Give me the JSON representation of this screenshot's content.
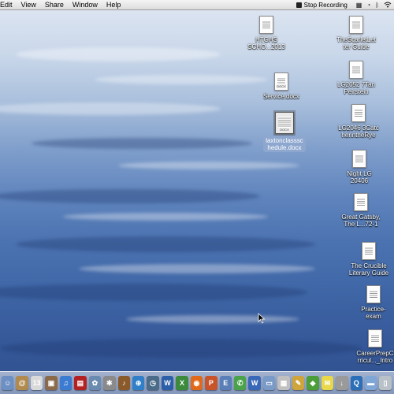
{
  "menubar": {
    "items": [
      "Edit",
      "View",
      "Share",
      "Window",
      "Help"
    ],
    "stop_recording": "Stop Recording"
  },
  "desktop_icons": [
    {
      "label1": "HTGHS",
      "label2": "SCHO...2013",
      "badge": "",
      "selected": false
    },
    {
      "label1": "TheScarletLet",
      "label2": "ter Guide",
      "badge": "",
      "selected": false
    },
    {
      "label1": "LG2052 7Tan",
      "label2": "Peirstein",
      "badge": "",
      "selected": false
    },
    {
      "label1": "Service.docx",
      "label2": "",
      "badge": "DOCX",
      "selected": false
    },
    {
      "label1": "laxtonclasssc",
      "label2": "hedule.docx",
      "badge": "DOCX",
      "selected": true
    },
    {
      "label1": "LG2046 3Catc",
      "label2": "herintheRye",
      "badge": "",
      "selected": false
    },
    {
      "label1": "Night LG",
      "label2": "20406",
      "badge": "",
      "selected": false
    },
    {
      "label1": "Great Gatsby,",
      "label2": "The L...72-1",
      "badge": "",
      "selected": false
    },
    {
      "label1": "The Crucible",
      "label2": "Literary Guide",
      "badge": "",
      "selected": false
    },
    {
      "label1": "Practice-",
      "label2": "exam",
      "badge": "",
      "selected": false
    },
    {
      "label1": "CareerPrepC",
      "label2": "rricul..._Intro",
      "badge": "",
      "selected": false
    }
  ],
  "dock": {
    "items": [
      {
        "icon": "finder-icon",
        "color": "#6c8fc4",
        "glyph": "☺"
      },
      {
        "icon": "address-book-icon",
        "color": "#b08a4e",
        "glyph": "@"
      },
      {
        "icon": "calendar-icon",
        "color": "#d9d9d9",
        "glyph": "13"
      },
      {
        "icon": "photos-icon",
        "color": "#8a6a4a",
        "glyph": "▣"
      },
      {
        "icon": "itunes-icon",
        "color": "#3b7bd1",
        "glyph": "♫"
      },
      {
        "icon": "photo-booth-icon",
        "color": "#b32222",
        "glyph": "▤"
      },
      {
        "icon": "iphoto-icon",
        "color": "#6a8ab0",
        "glyph": "✿"
      },
      {
        "icon": "system-preferences-icon",
        "color": "#8a8a8a",
        "glyph": "✱"
      },
      {
        "icon": "garageband-icon",
        "color": "#8b5a2b",
        "glyph": "♪"
      },
      {
        "icon": "safari-icon",
        "color": "#2f7fc9",
        "glyph": "⊕"
      },
      {
        "icon": "time-machine-icon",
        "color": "#4a6c8a",
        "glyph": "◷"
      },
      {
        "icon": "word-icon",
        "color": "#2d5fa8",
        "glyph": "W"
      },
      {
        "icon": "excel-icon",
        "color": "#3c8a3c",
        "glyph": "X"
      },
      {
        "icon": "firefox-icon",
        "color": "#e06a1a",
        "glyph": "◉"
      },
      {
        "icon": "powerpoint-icon",
        "color": "#c9542a",
        "glyph": "P"
      },
      {
        "icon": "entourage-icon",
        "color": "#5a7fb8",
        "glyph": "E"
      },
      {
        "icon": "messenger-icon",
        "color": "#4aa24a",
        "glyph": "✆"
      },
      {
        "icon": "word-doc-icon",
        "color": "#3a68b8",
        "glyph": "W"
      },
      {
        "icon": "preview-icon",
        "color": "#7a9ac8",
        "glyph": "▭"
      },
      {
        "icon": "documents-icon",
        "color": "#c0c0c0",
        "glyph": "▦"
      },
      {
        "icon": "pages-icon",
        "color": "#cfa43a",
        "glyph": "✎"
      },
      {
        "icon": "app-icon",
        "color": "#4c9f38",
        "glyph": "◆"
      },
      {
        "icon": "notes-icon",
        "color": "#e8d84a",
        "glyph": "✉"
      },
      {
        "icon": "downloads-icon",
        "color": "#9a9a9a",
        "glyph": "↓"
      },
      {
        "icon": "quicktime-icon",
        "color": "#2b6fb8",
        "glyph": "Q"
      },
      {
        "icon": "folder-icon",
        "color": "#7ea7d8",
        "glyph": "▬"
      },
      {
        "icon": "trash-icon",
        "color": "#b8c0c8",
        "glyph": "▯"
      }
    ]
  }
}
